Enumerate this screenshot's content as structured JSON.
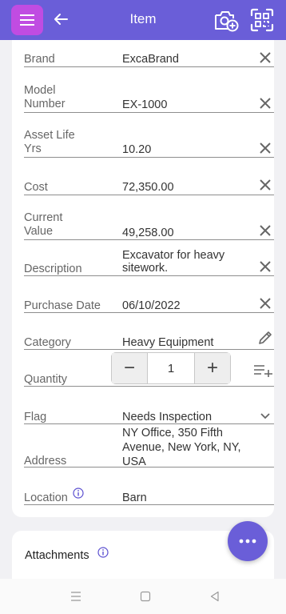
{
  "header": {
    "title": "Item",
    "background": "#6a5ed8",
    "menu_accent": "#c04ce2",
    "icons": [
      "menu-icon",
      "back-arrow-icon",
      "camera-add-icon",
      "qr-scan-icon"
    ]
  },
  "fields": {
    "brand": {
      "label": "Brand",
      "value": "ExcaBrand"
    },
    "model_number": {
      "label_line1": "Model",
      "label_line2": "Number",
      "value": "EX-1000"
    },
    "asset_life": {
      "label_line1": "Asset Life",
      "label_line2": "Yrs",
      "value": "10.20"
    },
    "cost": {
      "label": "Cost",
      "value": "72,350.00"
    },
    "current_value": {
      "label_line1": "Current",
      "label_line2": "Value",
      "value": "49,258.00"
    },
    "description": {
      "label": "Description",
      "value_line1": "Excavator for heavy",
      "value_line2": "sitework."
    },
    "purchase_date": {
      "label": "Purchase Date",
      "value": "06/10/2022"
    },
    "category": {
      "label": "Category",
      "value": "Heavy Equipment"
    },
    "quantity": {
      "label": "Quantity",
      "value": "1",
      "minus": "−",
      "plus": "+"
    },
    "flag": {
      "label": "Flag",
      "value": "Needs Inspection"
    },
    "address": {
      "label": "Address",
      "value_line1": "NY Office, 350 Fifth",
      "value_line2": "Avenue, New York, NY,",
      "value_line3": "USA"
    },
    "location": {
      "label": "Location",
      "value": "Barn"
    }
  },
  "attachments": {
    "label": "Attachments"
  },
  "fab": {
    "icon": "more-dots-icon",
    "color": "#6a5ed8"
  },
  "system_nav": {
    "icons": [
      "recents-icon",
      "home-icon",
      "back-triangle-icon"
    ]
  }
}
